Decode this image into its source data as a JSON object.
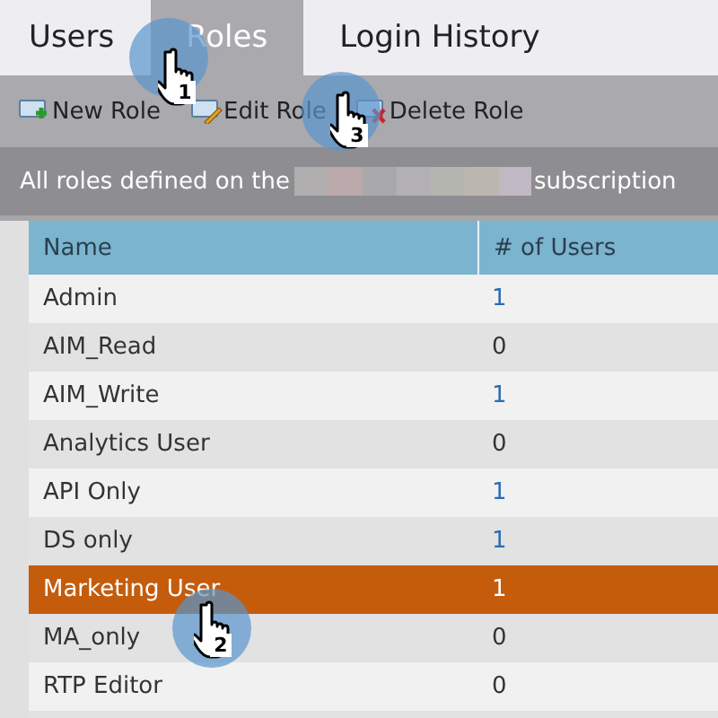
{
  "tabs": [
    {
      "label": "Users",
      "selected": false
    },
    {
      "label": "Roles",
      "selected": true
    },
    {
      "label": "Login History",
      "selected": false
    }
  ],
  "toolbar": [
    {
      "kind": "new",
      "label": "New Role"
    },
    {
      "kind": "edit",
      "label": "Edit Role"
    },
    {
      "kind": "delete",
      "label": "Delete Role"
    }
  ],
  "info_bar": {
    "before": "All roles defined on the",
    "after": "subscription"
  },
  "table": {
    "columns": [
      "Name",
      "# of Users"
    ],
    "rows": [
      {
        "name": "Admin",
        "count": "1",
        "count_link": true,
        "selected": false
      },
      {
        "name": "AIM_Read",
        "count": "0",
        "count_link": false,
        "selected": false
      },
      {
        "name": "AIM_Write",
        "count": "1",
        "count_link": true,
        "selected": false
      },
      {
        "name": "Analytics User",
        "count": "0",
        "count_link": false,
        "selected": false
      },
      {
        "name": "API Only",
        "count": "1",
        "count_link": true,
        "selected": false
      },
      {
        "name": "DS only",
        "count": "1",
        "count_link": true,
        "selected": false
      },
      {
        "name": "Marketing User",
        "count": "1",
        "selected": true
      },
      {
        "name": "MA_only",
        "count": "0",
        "count_link": false,
        "selected": false
      },
      {
        "name": "RTP Editor",
        "count": "0",
        "count_link": false,
        "selected": false
      }
    ]
  },
  "callouts": [
    {
      "number": "1"
    },
    {
      "number": "2"
    },
    {
      "number": "3"
    }
  ]
}
